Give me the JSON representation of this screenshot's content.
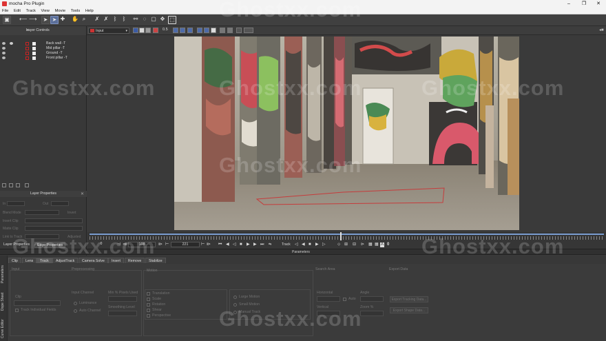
{
  "window": {
    "title": "mocha Pro Plugin",
    "controls": [
      "–",
      "❐",
      "✕"
    ]
  },
  "menu": [
    "File",
    "Edit",
    "Track",
    "View",
    "Movie",
    "Tools",
    "Help"
  ],
  "layer_controls": {
    "title": "Layer Controls",
    "layers": [
      {
        "name": "Back wall -T"
      },
      {
        "name": "Mid pillar -T"
      },
      {
        "name": "Ground -T"
      },
      {
        "name": "Front pillar -T"
      }
    ]
  },
  "viewer": {
    "input_select": "Input",
    "zoom": "0.5"
  },
  "layer_properties": {
    "title": "Layer Properties",
    "fields": [
      "In",
      "Out",
      "Blend Mode",
      "Invert",
      "Insert Clip",
      "Matte Clip",
      "Link to Track",
      "Adjusted"
    ]
  },
  "left_tabs": [
    "Layer Properties",
    "Edge Properties"
  ],
  "transport": {
    "start_frame": "0",
    "current_frame": "108",
    "end_frame": "221",
    "track_label": "Track"
  },
  "parameters": {
    "title": "Parameters",
    "tabs": [
      "Clip",
      "Lens",
      "Track",
      "AdjustTrack",
      "Camera Solve",
      "Insert",
      "Remove",
      "Stabilize"
    ],
    "selected_tab": "Track",
    "vertical_tabs": [
      "Parameters",
      "Dope Sheet",
      "Curve Editor"
    ],
    "input": {
      "title": "Input",
      "clip_label": "Clip",
      "track_individual_fields": "Track Individual Fields",
      "preprocessing_title": "Preprocessing",
      "input_channel_label": "Input Channel",
      "luminance": "Luminance",
      "auto_channel": "Auto Channel",
      "min_pixels_used": "Min % Pixels Used",
      "smoothing_level": "Smoothing Level"
    },
    "motion": {
      "title": "Motion",
      "options": [
        "Translation",
        "Scale",
        "Rotation",
        "Shear",
        "Perspective"
      ],
      "large_motion": "Large Motion",
      "small_motion": "Small Motion",
      "manual_track": "Manual Track"
    },
    "search_area": {
      "title": "Search Area",
      "horizontal": "Horizontal",
      "vertical": "Vertical",
      "auto": "Auto",
      "angle": "Angle",
      "zoom": "Zoom %"
    },
    "export_data": {
      "title": "Export Data",
      "export_tracking": "Export Tracking Data...",
      "export_shape": "Export Shape Data..."
    }
  },
  "watermark": "Ghostxx.com"
}
